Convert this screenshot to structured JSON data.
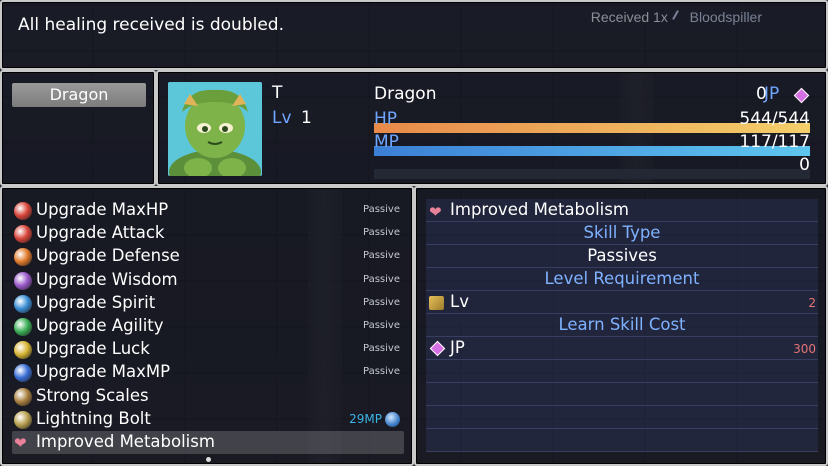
{
  "help": {
    "text": "All healing received is doubled.",
    "received_label": "Received",
    "received_count": "1x",
    "received_source": "Bloodspiller"
  },
  "skill_type": {
    "label": "Dragon"
  },
  "actor": {
    "name": "T",
    "level_label": "Lv",
    "level": "1",
    "class": "Dragon",
    "jp_value": "0",
    "jp_label": "JP",
    "hp_label": "HP",
    "hp": "544/544",
    "hp_ratio": 1.0,
    "mp_label": "MP",
    "mp": "117/117",
    "mp_ratio": 1.0,
    "tp": "0",
    "tp_ratio": 0.0
  },
  "colors": {
    "system": "#6fa6ff",
    "hp_gauge_start": "#e88a4a",
    "hp_gauge_end": "#f3cf6a",
    "mp_gauge_start": "#3c7fd6",
    "mp_gauge_end": "#5ec6ef",
    "cost_red": "#e57373"
  },
  "skills": [
    {
      "name": "Upgrade MaxHP",
      "cost": "Passive",
      "icon": "red-orb-icon",
      "color": "#d8453a"
    },
    {
      "name": "Upgrade Attack",
      "cost": "Passive",
      "icon": "red-orb-icon",
      "color": "#d8453a"
    },
    {
      "name": "Upgrade Defense",
      "cost": "Passive",
      "icon": "orange-orb-icon",
      "color": "#e07a2b"
    },
    {
      "name": "Upgrade Wisdom",
      "cost": "Passive",
      "icon": "purple-orb-icon",
      "color": "#9a59c9"
    },
    {
      "name": "Upgrade Spirit",
      "cost": "Passive",
      "icon": "blue-orb-icon",
      "color": "#3a8fd6"
    },
    {
      "name": "Upgrade Agility",
      "cost": "Passive",
      "icon": "green-orb-icon",
      "color": "#3bb056"
    },
    {
      "name": "Upgrade Luck",
      "cost": "Passive",
      "icon": "yellow-orb-icon",
      "color": "#d6b433"
    },
    {
      "name": "Upgrade MaxMP",
      "cost": "Passive",
      "icon": "blue-orb-icon",
      "color": "#3a6fd6"
    },
    {
      "name": "Strong Scales",
      "cost": "",
      "icon": "scales-icon",
      "color": "#a9803f"
    },
    {
      "name": "Lightning Bolt",
      "cost": "29MP",
      "icon": "lightning-icon",
      "color": "#b8a050"
    },
    {
      "name": "Improved Metabolism",
      "cost": "",
      "icon": "heart-icon",
      "color": "#e8829b"
    }
  ],
  "detail": {
    "title": "Improved Metabolism",
    "skill_type_label": "Skill Type",
    "skill_type_value": "Passives",
    "level_req_label": "Level Requirement",
    "lv_label": "Lv",
    "lv_value": "2",
    "cost_label": "Learn Skill Cost",
    "jp_label": "JP",
    "jp_value": "300"
  }
}
